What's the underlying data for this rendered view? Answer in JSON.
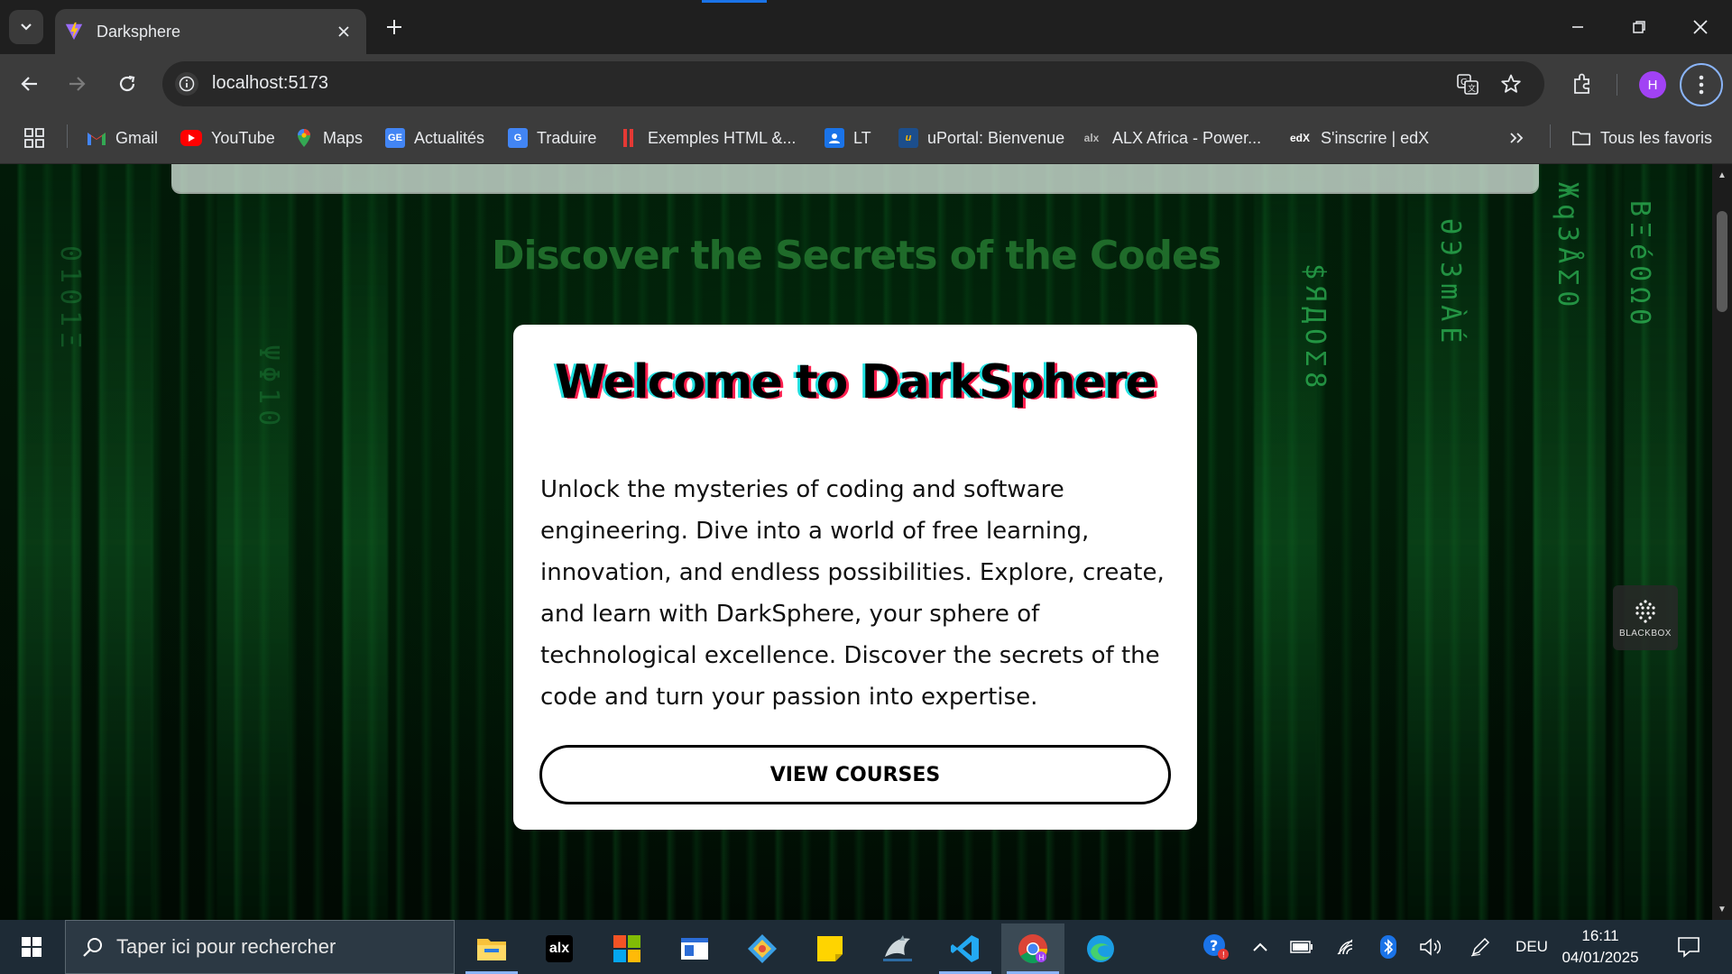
{
  "browser": {
    "tab_title": "Darksphere",
    "url": "localhost:5173",
    "profile_initial": "H"
  },
  "bookmarks": [
    {
      "label": "Gmail",
      "icon": "gmail-icon"
    },
    {
      "label": "YouTube",
      "icon": "youtube-icon"
    },
    {
      "label": "Maps",
      "icon": "maps-icon"
    },
    {
      "label": "Actualités",
      "icon": "news-icon"
    },
    {
      "label": "Traduire",
      "icon": "translate-icon"
    },
    {
      "label": "Exemples HTML &...",
      "icon": "html-examples-icon"
    },
    {
      "label": "LT",
      "icon": "lt-icon"
    },
    {
      "label": "uPortal: Bienvenue",
      "icon": "uportal-icon"
    },
    {
      "label": "ALX Africa - Power...",
      "icon": "alx-icon"
    },
    {
      "label": "S'inscrire | edX",
      "icon": "edx-icon"
    }
  ],
  "all_bookmarks_label": "Tous les favoris",
  "page": {
    "headline": "Discover the Secrets of the Codes",
    "card_title": "Welcome to DarkSphere",
    "card_body": "Unlock the mysteries of coding and software engineering. Dive into a world of free learning, innovation, and endless possibilities. Explore, create, and learn with DarkSphere, your sphere of technological excellence. Discover the secrets of the code and turn your passion into expertise.",
    "cta_label": "VIEW COURSES",
    "blackbox_label": "BLACKBOX"
  },
  "taskbar": {
    "search_placeholder": "Taper ici pour rechercher",
    "language": "DEU",
    "time": "16:11",
    "date": "04/01/2025"
  },
  "colors": {
    "headline": "#1f6b2a",
    "accent": "#8ab4f8",
    "profile": "#a142f4"
  }
}
